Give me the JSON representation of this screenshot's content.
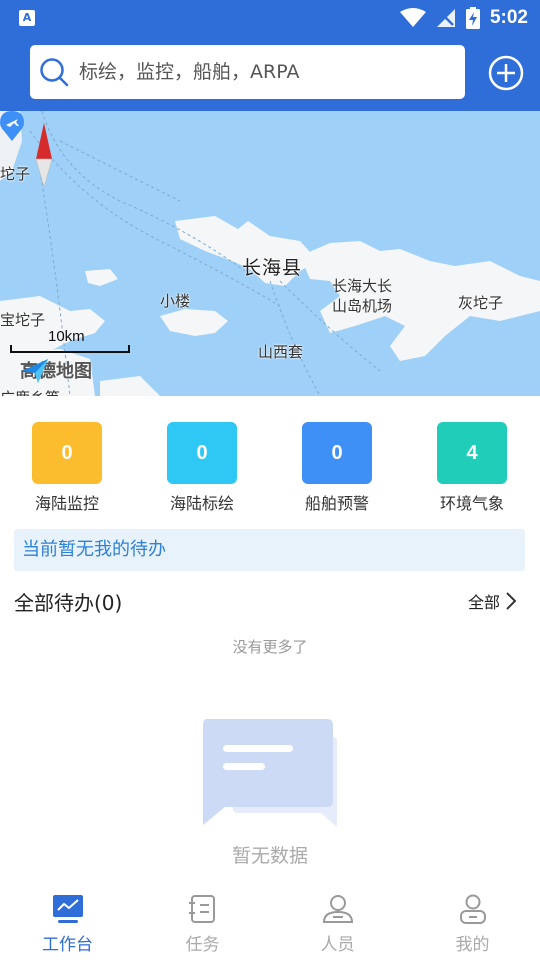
{
  "statusbar": {
    "time": "5:02",
    "app_icon": "A",
    "icons": [
      "wifi-icon",
      "no-signal-icon",
      "battery-charging-icon"
    ]
  },
  "search": {
    "placeholder": "标绘，监控，船舶，ARPA"
  },
  "map": {
    "labels": {
      "top_left": "坨子",
      "county": "长海县",
      "airport": "长海大长\n山岛机场",
      "airport_line1": "长海大长",
      "airport_line2": "山岛机场",
      "xiaolou": "小楼",
      "baotuozi": "宝坨子",
      "huituozi": "灰坨子",
      "shanxitao": "山西套",
      "bottom_left": "广鹿乡等"
    },
    "scale": "10km",
    "provider": "高德地图"
  },
  "tiles": [
    {
      "label": "海陆监控",
      "count": "0",
      "color": "#fbbd2d"
    },
    {
      "label": "海陆标绘",
      "count": "0",
      "color": "#2fc8f5"
    },
    {
      "label": "船舶预警",
      "count": "0",
      "color": "#3e8ff6"
    },
    {
      "label": "环境气象",
      "count": "4",
      "color": "#1fcdb9"
    }
  ],
  "banner": "当前暂无我的待办",
  "todo": {
    "title": "全部待办(0)",
    "all_link": "全部",
    "no_more": "没有更多了"
  },
  "empty": {
    "text": "暂无数据"
  },
  "nav": [
    {
      "label": "工作台",
      "icon": "dashboard-icon",
      "active": true
    },
    {
      "label": "任务",
      "icon": "task-list-icon",
      "active": false
    },
    {
      "label": "人员",
      "icon": "personnel-icon",
      "active": false
    },
    {
      "label": "我的",
      "icon": "profile-icon",
      "active": false
    }
  ],
  "colors": {
    "header": "#2f6ed9",
    "map_water": "#9fd0f7",
    "accent_blue": "#2f6ed9",
    "banner_text": "#2f82d6"
  }
}
